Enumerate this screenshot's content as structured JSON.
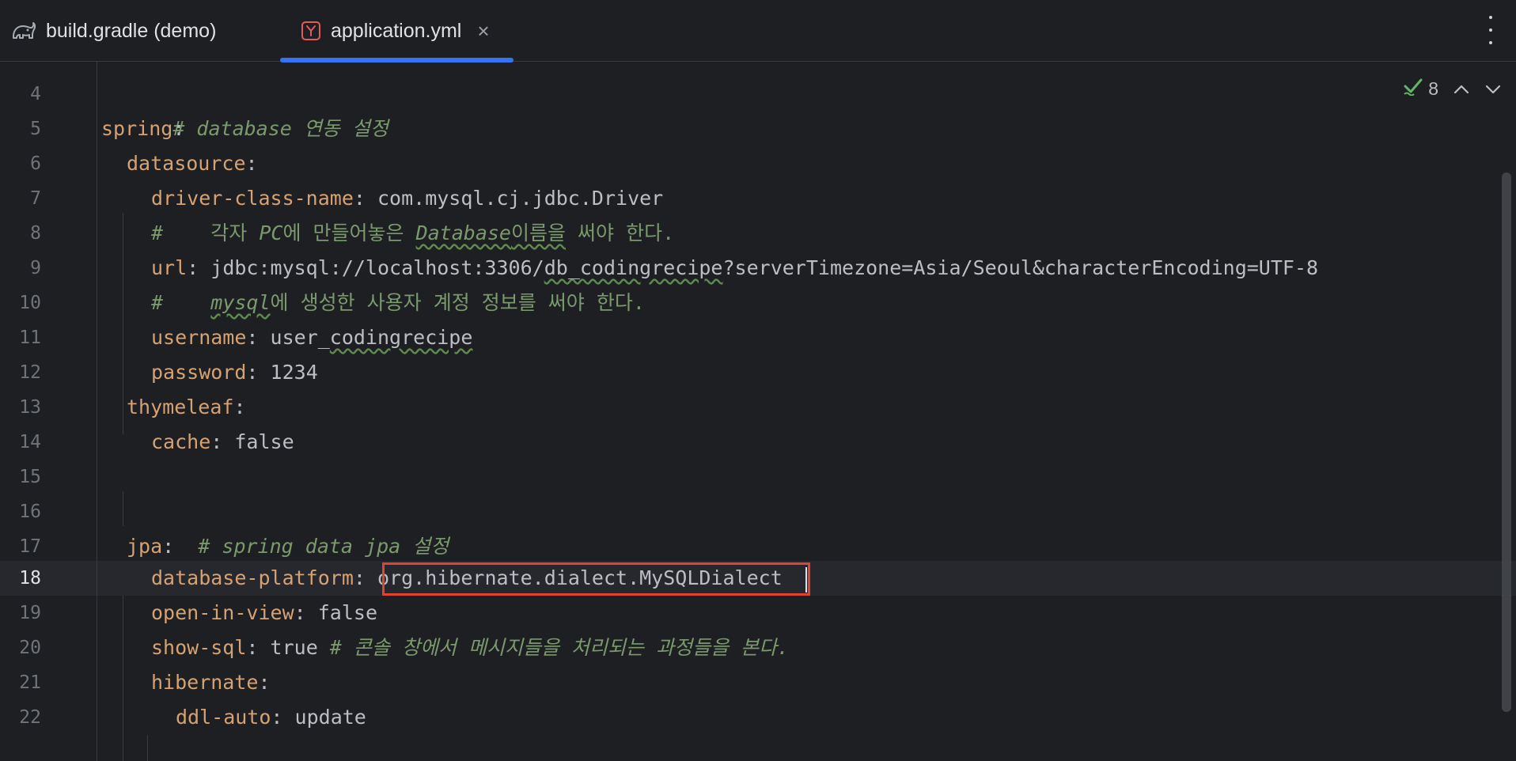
{
  "tabs": [
    {
      "label": "build.gradle (demo)",
      "icon": "gradle-elephant-icon",
      "active": false
    },
    {
      "label": "application.yml",
      "icon": "yaml-file-icon",
      "active": true,
      "close_glyph": "×"
    }
  ],
  "inspection": {
    "count": "8"
  },
  "current_line": 18,
  "line_numbers": [
    "4",
    "5",
    "6",
    "7",
    "8",
    "9",
    "10",
    "11",
    "12",
    "13",
    "14",
    "15",
    "16",
    "17",
    "18",
    "19",
    "20",
    "21",
    "22"
  ],
  "code": {
    "l4": {
      "comment": "# database 연동 설정"
    },
    "l5": {
      "key": "spring",
      "colon": ":"
    },
    "l6": {
      "key": "datasource",
      "colon": ":"
    },
    "l7": {
      "key": "driver-class-name",
      "colon": ":",
      "value": " com.mysql.cj.jdbc.Driver"
    },
    "l8": {
      "hash": "#",
      "pad": "    ",
      "t1": "각자 ",
      "t2": "PC",
      "t3": "에 만들어놓은 ",
      "t4": "Database",
      "t5": "이름을",
      "t6": " 써야 한다."
    },
    "l9": {
      "key": "url",
      "colon": ":",
      "v1": " jdbc:mysql://localhost:3306/",
      "v2": "db_codingrecipe",
      "v3": "?serverTimezone=Asia/Seoul&characterEncoding=UTF-8"
    },
    "l10": {
      "hash": "#",
      "pad": "    ",
      "t1": "mysql",
      "t2": "에 생성한 사용자 계정 정보를 써야 한다."
    },
    "l11": {
      "key": "username",
      "colon": ":",
      "v1": " user_",
      "v2": "codingrecipe"
    },
    "l12": {
      "key": "password",
      "colon": ":",
      "value": " 1234"
    },
    "l13": {
      "key": "thymeleaf",
      "colon": ":"
    },
    "l14": {
      "key": "cache",
      "colon": ":",
      "value": " false"
    },
    "l16": {
      "comment": "# spring data jpa 설정"
    },
    "l17": {
      "key": "jpa",
      "colon": ":"
    },
    "l18": {
      "key": "database-platform",
      "colon": ":",
      "value": "org.hibernate.dialect.MySQLDialect"
    },
    "l19": {
      "key": "open-in-view",
      "colon": ":",
      "value": " false"
    },
    "l20": {
      "key": "show-sql",
      "colon": ":",
      "value": " true ",
      "comment": "# 콘솔 창에서 메시지들을 처리되는 과정들을 본다."
    },
    "l21": {
      "key": "hibernate",
      "colon": ":"
    },
    "l22": {
      "key": "ddl-auto",
      "colon": ":",
      "value": " update"
    }
  },
  "colors": {
    "background": "#1e1f22",
    "key": "#d5a273",
    "comment": "#7a9a6e",
    "accent": "#3574f0",
    "highlight_box": "#e0432e"
  }
}
